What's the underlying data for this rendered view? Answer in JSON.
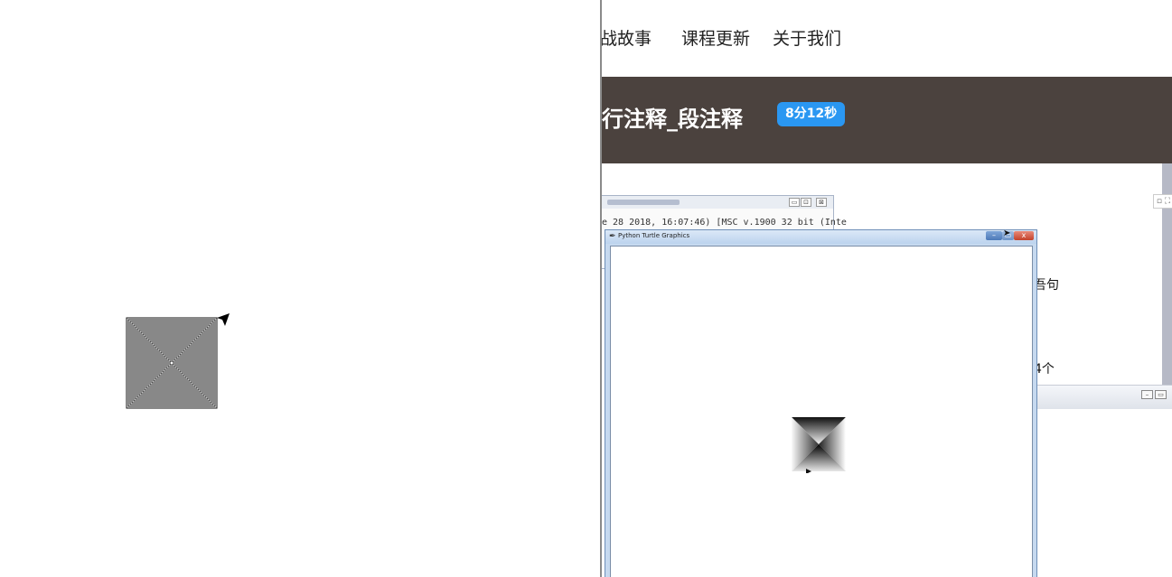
{
  "left_canvas": {
    "shape_icon": "turtle-arrow-icon"
  },
  "browser": {
    "nav": {
      "items": [
        "战故事",
        "课程更新",
        "关于我们"
      ]
    },
    "lesson": {
      "title": "行注释_段注释",
      "duration": "8分12秒"
    },
    "page_snippets": [
      "吾句",
      "4个"
    ],
    "colors": {
      "header_bg": "#4b423e",
      "badge_bg": "#2a97f2"
    }
  },
  "shell_window": {
    "text_line": "e 28 2018, 16:07:46) [MSC v.1900 32 bit (Inte",
    "controls": [
      "▭",
      "⊡",
      "⊠"
    ]
  },
  "turtle_window": {
    "title": "Python Turtle Graphics",
    "controls": {
      "minimize": "–",
      "maximize": "▭",
      "close": "x"
    },
    "icon": "feather-icon"
  }
}
